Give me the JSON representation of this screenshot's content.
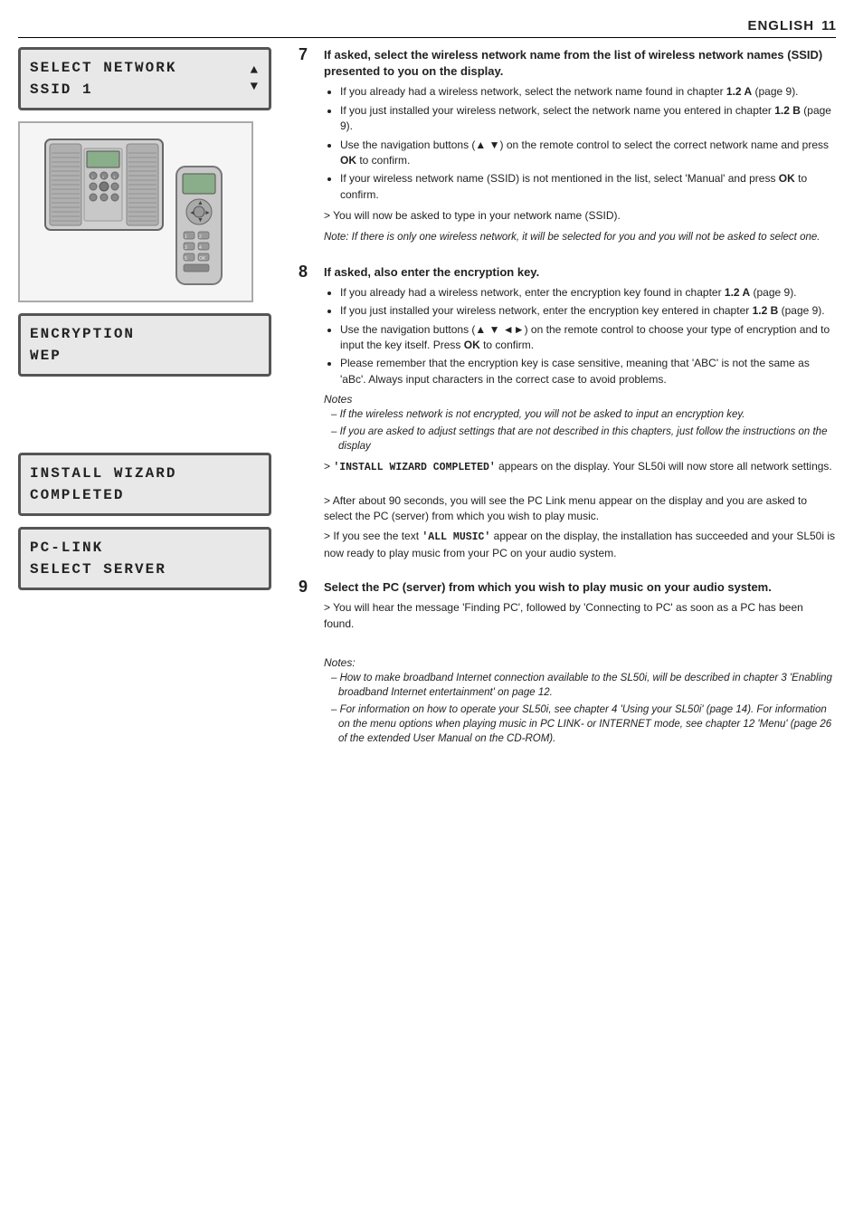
{
  "header": {
    "lang": "ENGLISH",
    "page_num": "11"
  },
  "left_column": {
    "lcd_select_network": {
      "line1": "SELECT NETWORK",
      "line2": "SSID  1",
      "has_arrows": true,
      "arrow_up": "▲",
      "arrow_down": "▼"
    },
    "device_image_alt": "SL50i device with remote",
    "lcd_encryption": {
      "line1": "ENCRYPTION",
      "line2": "WEP",
      "has_arrows": false
    },
    "lcd_install_wizard": {
      "line1": "INSTALL WIZARD",
      "line2": "COMPLETED",
      "has_arrows": false
    },
    "lcd_pc_link": {
      "line1": "PC-LINK",
      "line2": "SELECT SERVER",
      "has_arrows": false
    }
  },
  "steps": [
    {
      "number": "7",
      "title": "If asked, select the wireless network name from the list of wireless network names (SSID) presented to you on the display.",
      "bullets": [
        "If you already had a wireless network, select the network name found in chapter 1.2 A (page 9).",
        "If you just installed your wireless network, select the network name you entered in chapter 1.2 B (page 9).",
        "Use the navigation buttons (▲ ▼) on the remote control to select the correct network name and press OK to confirm.",
        "If your wireless network name (SSID) is not mentioned in the list, select 'Manual' and press OK to confirm."
      ],
      "arrow_texts": [
        "You will now be asked to type in your network name (SSID)."
      ],
      "notes": [
        "Note: If there is only one wireless network, it will be selected for you and you will not be asked to select one."
      ],
      "notes_label": ""
    },
    {
      "number": "8",
      "title": "If asked, also enter the encryption key.",
      "bullets": [
        "If you already had a wireless network, enter the encryption key found in chapter 1.2 A (page 9).",
        "If you just installed your wireless network, enter the encryption key entered in chapter 1.2 B (page 9).",
        "Use the navigation buttons (▲ ▼ ◄►) on the remote control to choose your type of encryption and to input the key itself. Press OK to confirm.",
        "Please remember that the encryption key is case sensitive, meaning that 'ABC' is not the same as 'aBc'. Always input characters in the correct case to avoid problems."
      ],
      "notes_section": {
        "label": "Notes",
        "items": [
          "If the wireless network is not encrypted, you will not be asked to input an encryption key.",
          "If you are asked to adjust settings that are not described in this chapters, just follow the instructions on the display"
        ]
      },
      "arrow_texts": [
        "'INSTALL WIZARD COMPLETED' appears on the display. Your SL50i will now store all network settings.",
        "After about 90 seconds, you will see the PC Link menu appear on the display and you are asked to select the PC (server) from which you wish to play music.",
        "If you see the text 'ALL MUSIC' appear on the display, the installation has succeeded and your SL50i is now ready to play music from your PC on your audio system."
      ]
    },
    {
      "number": "9",
      "title": "Select the PC (server) from which you wish to play music on your audio system.",
      "bullets": [],
      "arrow_texts": [
        "You will hear the message 'Finding PC', followed by 'Connecting to PC' as soon as a PC has been found."
      ],
      "bottom_notes": {
        "label": "Notes:",
        "items": [
          "How to make broadband Internet connection available to the SL50i, will be described in chapter 3 'Enabling broadband Internet entertainment' on page 12.",
          "For information on how to operate your SL50i, see chapter 4 'Using your SL50i' (page 14). For information on the menu options when playing music in PC LINK- or INTERNET mode, see chapter 12 'Menu' (page 26 of the extended User Manual on the CD-ROM)."
        ]
      }
    }
  ]
}
